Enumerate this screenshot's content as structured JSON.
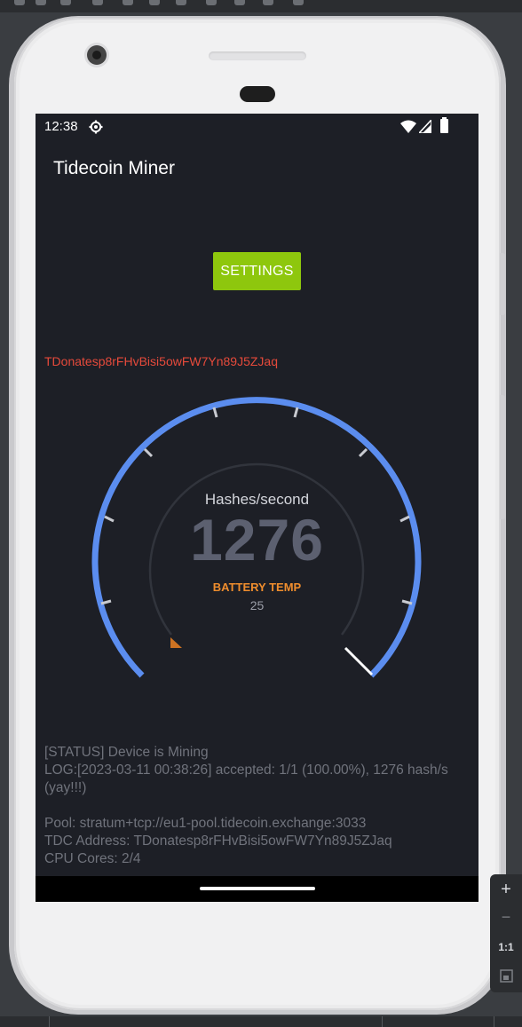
{
  "status_bar": {
    "time": "12:38",
    "icons": [
      "gear-icon",
      "wifi-icon",
      "signal-icon",
      "battery-icon"
    ]
  },
  "app": {
    "title": "Tidecoin Miner",
    "settings_label": "SETTINGS",
    "address_display": "TDonatesp8rFHvBisi5owFW7Yn89J5ZJaq"
  },
  "gauge": {
    "label": "Hashes/second",
    "value": "1276",
    "temp_label": "BATTERY TEMP",
    "temp_value": "25"
  },
  "log": {
    "status": "[STATUS] Device is Mining",
    "log_line": "LOG:[2023-03-11 00:38:26] accepted: 1/1 (100.00%), 1276 hash/s (yay!!!)",
    "pool": "Pool: stratum+tcp://eu1-pool.tidecoin.exchange:3033",
    "address": "TDC Address: TDonatesp8rFHvBisi5owFW7Yn89J5ZJaq",
    "cores": "CPU Cores: 2/4"
  },
  "emulator_controls": {
    "zoom_in": "+",
    "zoom_out": "−",
    "actual_size": "1:1"
  },
  "colors": {
    "screen_bg": "#1d1f26",
    "gauge_arc": "#5b8def",
    "settings_button": "#8ec70d",
    "address_red": "#e64a3b",
    "temp_label": "#ef8d2d"
  }
}
